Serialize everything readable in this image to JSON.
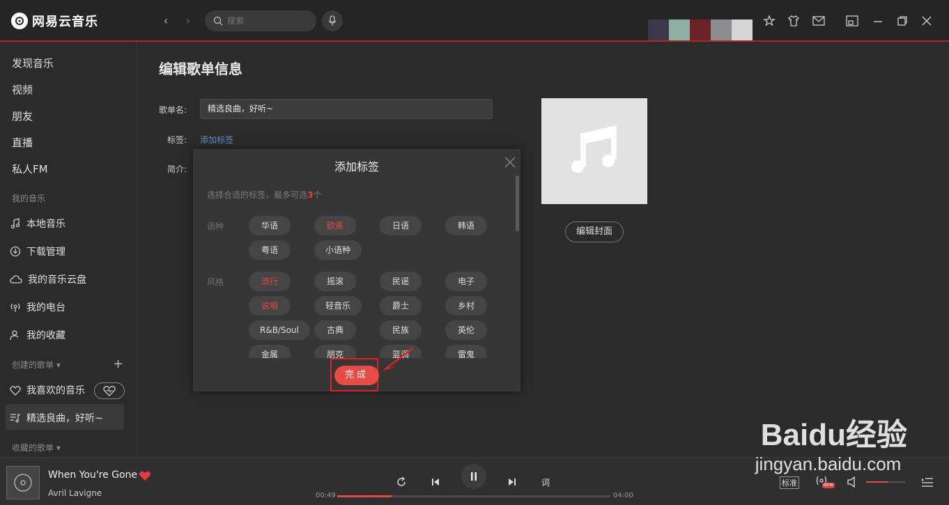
{
  "app": {
    "name": "网易云音乐"
  },
  "search": {
    "placeholder": "搜索"
  },
  "theme_swatches": [
    "#3a3849",
    "#8fb0a4",
    "#6b2326",
    "#8d8d8f",
    "#d6d6d6"
  ],
  "sidebar": {
    "top_items": [
      "发现音乐",
      "视频",
      "朋友",
      "直播",
      "私人FM"
    ],
    "my_music_header": "我的音乐",
    "my_music": [
      {
        "label": "本地音乐",
        "icon": "music-note-icon"
      },
      {
        "label": "下载管理",
        "icon": "download-icon"
      },
      {
        "label": "我的音乐云盘",
        "icon": "cloud-icon"
      },
      {
        "label": "我的电台",
        "icon": "radio-icon"
      },
      {
        "label": "我的收藏",
        "icon": "user-icon"
      }
    ],
    "created_header": "创建的歌单",
    "created": [
      {
        "label": "我喜欢的音乐",
        "icon": "heart-icon"
      },
      {
        "label": "精选良曲，好听~",
        "icon": "playlist-icon"
      }
    ],
    "collected_header": "收藏的歌单"
  },
  "editor": {
    "title": "编辑歌单信息",
    "name_label": "歌单名:",
    "name_value": "精选良曲，好听~",
    "tag_label": "标签:",
    "add_tag_link": "添加标签",
    "intro_label": "简介:",
    "cover_button": "编辑封面"
  },
  "dialog": {
    "title": "添加标签",
    "hint_prefix": "选择合适的标签，最多可选",
    "hint_count": "3",
    "hint_suffix": "个",
    "categories": [
      {
        "label": "语种",
        "tags": [
          "华语",
          "欧美",
          "日语",
          "韩语",
          "粤语",
          "小语种"
        ],
        "active": [
          "欧美"
        ]
      },
      {
        "label": "风格",
        "tags": [
          "流行",
          "摇滚",
          "民谣",
          "电子",
          "说唱",
          "轻音乐",
          "爵士",
          "乡村",
          "R&B/Soul",
          "古典",
          "民族",
          "英伦",
          "金属",
          "朋克",
          "蓝调",
          "雷鬼"
        ],
        "active": [
          "流行",
          "说唱"
        ]
      }
    ],
    "done_button": "完成"
  },
  "player": {
    "song": "When You're Gone",
    "artist": "Avril Lavigne",
    "current_time": "00:49",
    "total_time": "04:00",
    "progress": 0.2,
    "lyrics_button": "词",
    "quality": "标准",
    "new_badge": "NEW",
    "volume": 0.55,
    "accent": "#e84a44"
  },
  "watermark": {
    "brand": "Baidu经验",
    "url": "jingyan.baidu.com"
  }
}
